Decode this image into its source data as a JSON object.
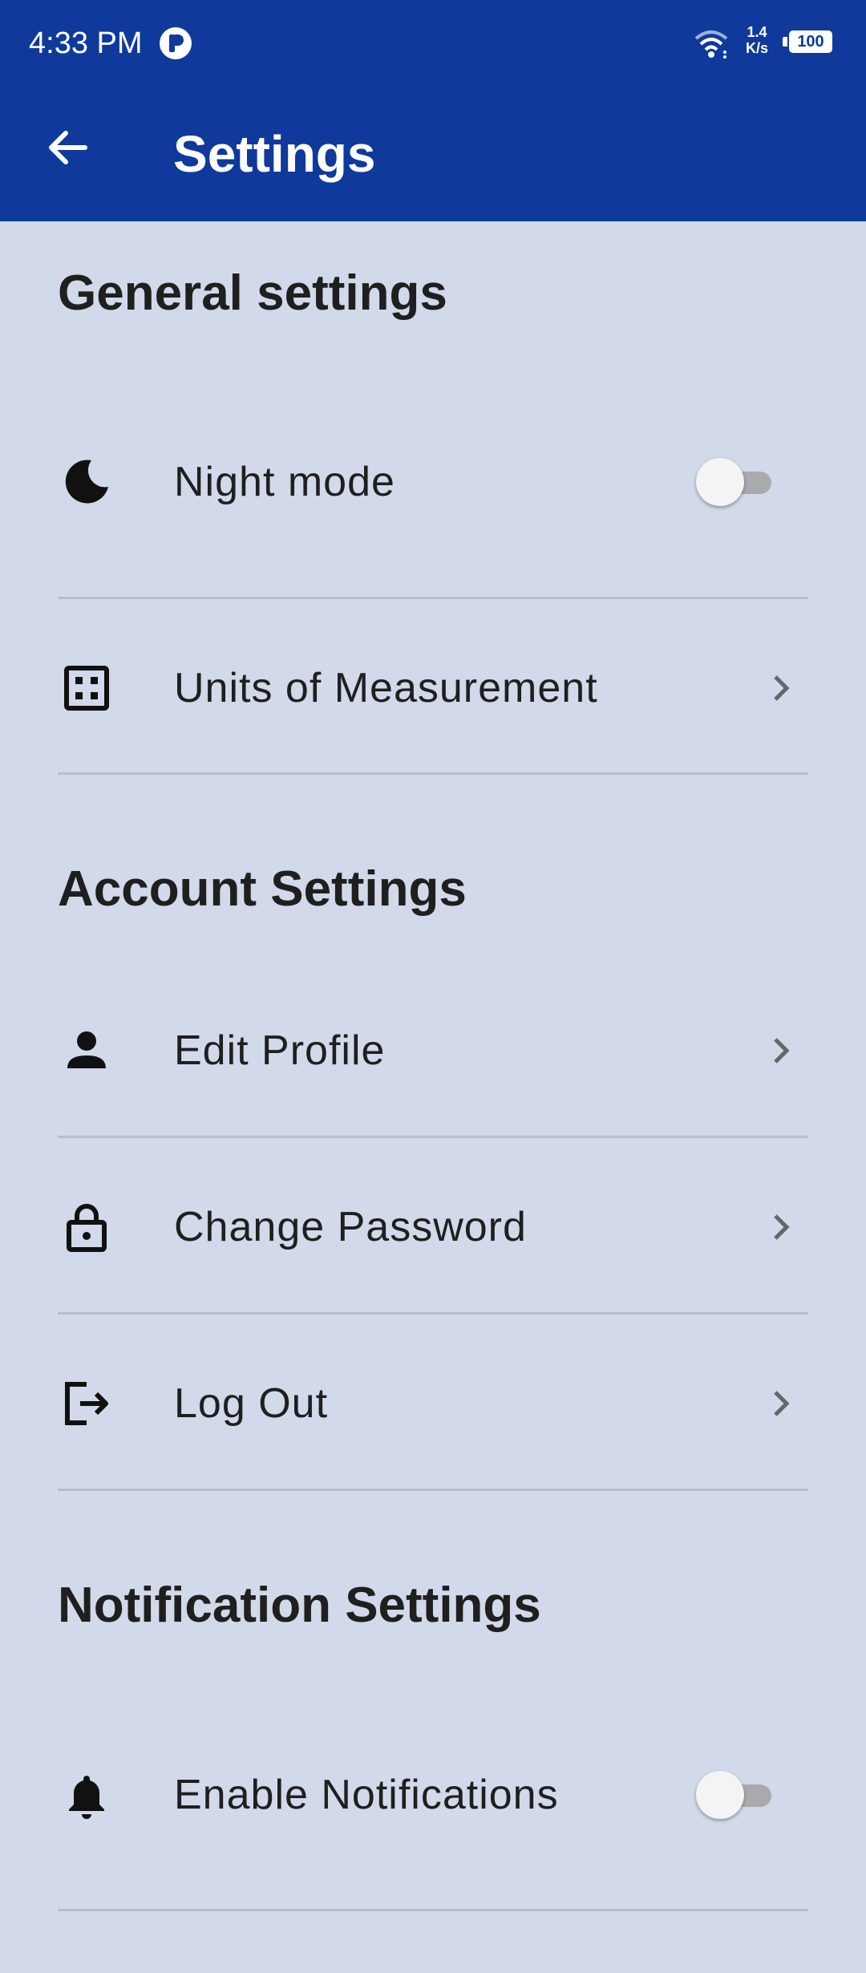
{
  "status_bar": {
    "time": "4:33 PM",
    "net_speed_value": "1.4",
    "net_speed_unit": "K/s",
    "battery": "100"
  },
  "app_bar": {
    "title": "Settings",
    "back_icon": "arrow-back-icon"
  },
  "sections": {
    "general": {
      "title": "General settings",
      "items": [
        {
          "label": "Night mode",
          "icon": "moon-icon",
          "control": "toggle",
          "enabled": false
        },
        {
          "label": "Units of Measurement",
          "icon": "measure-icon",
          "control": "chevron"
        }
      ]
    },
    "account": {
      "title": "Account Settings",
      "items": [
        {
          "label": "Edit Profile",
          "icon": "person-icon",
          "control": "chevron"
        },
        {
          "label": "Change Password",
          "icon": "lock-icon",
          "control": "chevron"
        },
        {
          "label": "Log Out",
          "icon": "logout-icon",
          "control": "chevron"
        }
      ]
    },
    "notifications": {
      "title": "Notification Settings",
      "items": [
        {
          "label": "Enable Notifications",
          "icon": "bell-icon",
          "control": "toggle",
          "enabled": false
        }
      ]
    }
  },
  "colors": {
    "app_bar": "#0f3a9b",
    "background": "#d1d9ea",
    "divider": "#b8bec9",
    "text": "#1f1f1f"
  }
}
